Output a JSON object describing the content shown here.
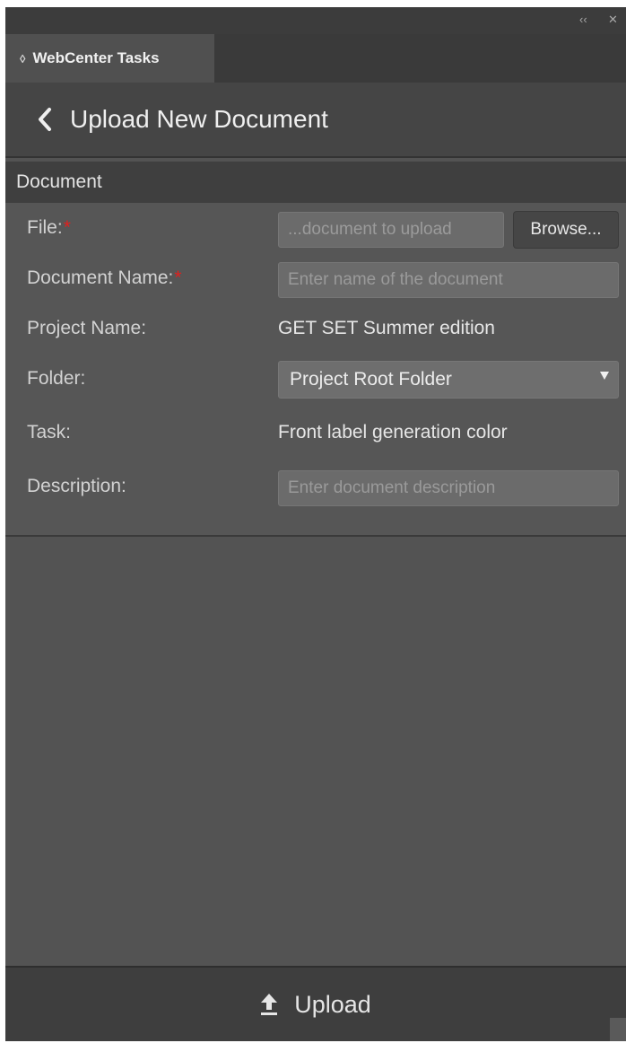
{
  "window": {
    "collapse_glyph": "‹‹",
    "close_glyph": "✕"
  },
  "tab": {
    "icon": "diamond-icon",
    "label": "WebCenter Tasks"
  },
  "header": {
    "back_icon": "chevron-left-icon",
    "title": "Upload New Document"
  },
  "section": {
    "title": "Document"
  },
  "form": {
    "file": {
      "label": "File:",
      "required_mark": "*",
      "value": "...document to upload",
      "browse_label": "Browse..."
    },
    "document_name": {
      "label": "Document Name:",
      "required_mark": "*",
      "placeholder": "Enter name of the document"
    },
    "project_name": {
      "label": "Project Name:",
      "value": "GET SET Summer edition"
    },
    "folder": {
      "label": "Folder:",
      "selected": "Project Root Folder",
      "icon": "caret-down-icon"
    },
    "task": {
      "label": "Task:",
      "value": "Front label generation color"
    },
    "description": {
      "label": "Description:",
      "placeholder": "Enter document description"
    }
  },
  "footer": {
    "upload_icon": "upload-icon",
    "upload_label": "Upload"
  },
  "colors": {
    "required": "#e0201e",
    "panel_bg": "#535353",
    "header_bg": "#454545"
  }
}
